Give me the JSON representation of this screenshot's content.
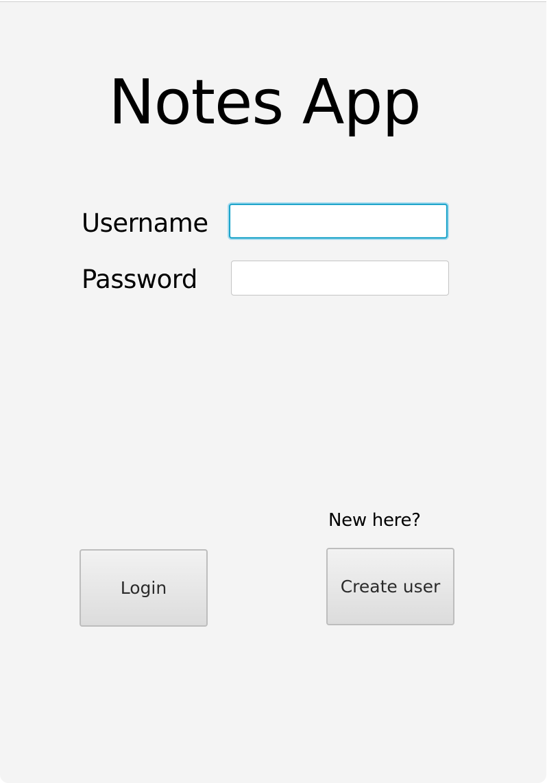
{
  "app": {
    "title": "Notes App"
  },
  "form": {
    "username_label": "Username",
    "username_value": "",
    "password_label": "Password",
    "password_value": ""
  },
  "actions": {
    "new_here_text": "New here?",
    "login_label": "Login",
    "create_user_label": "Create user"
  },
  "colors": {
    "background": "#f4f4f4",
    "focus_ring": "#1aa3c9"
  }
}
